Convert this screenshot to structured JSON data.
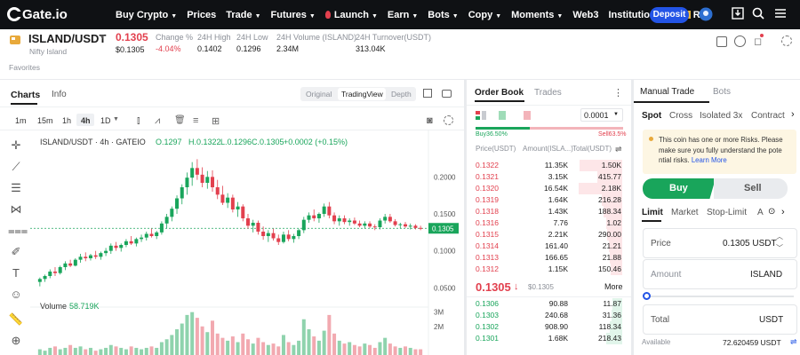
{
  "nav": {
    "logo": "Gate.io",
    "items": [
      {
        "label": "Buy Crypto",
        "caret": true
      },
      {
        "label": "Prices",
        "caret": false
      },
      {
        "label": "Trade",
        "caret": true
      },
      {
        "label": "Futures",
        "caret": true
      },
      {
        "label": "Launch",
        "caret": true
      },
      {
        "label": "Earn",
        "caret": true
      },
      {
        "label": "Bots",
        "caret": true
      },
      {
        "label": "Copy",
        "caret": true
      },
      {
        "label": "Moments",
        "caret": true
      },
      {
        "label": "Web3",
        "caret": false
      },
      {
        "label": "Institutional",
        "caret": true
      },
      {
        "label": "Re",
        "caret": false
      }
    ],
    "deposit": "Deposit"
  },
  "ticker": {
    "pair": "ISLAND/USDT",
    "name": "Nifty Island",
    "price": "0.1305",
    "price_usd": "$0.1305",
    "change_label": "Change %",
    "change_value": "-4.04%",
    "high_label": "24H High",
    "high_value": "0.1402",
    "low_label": "24H Low",
    "low_value": "0.1296",
    "volume_label": "24H Volume (ISLAND)",
    "volume_value": "2.34M",
    "turnover_label": "24H Turnover(USDT)",
    "turnover_value": "313.04K",
    "favorites": "Favorites"
  },
  "chart": {
    "tabs": {
      "charts": "Charts",
      "info": "Info"
    },
    "views": [
      "Original",
      "TradingView",
      "Depth"
    ],
    "timeframes": [
      "1m",
      "15m",
      "1h",
      "4h",
      "1D"
    ],
    "active_timeframe": "4h",
    "legend": {
      "symbol": "ISLAND/USDT · 4h · GATEIO",
      "o": "O.1297",
      "h": "H.0.1322",
      "l": "L.0.1296",
      "c": "C.0.1305",
      "chg": "+0.0002 (+0.15%)"
    },
    "volume_label": "Volume",
    "volume_value": "58.719K",
    "price_ticks": [
      "0.2000",
      "0.1500",
      "0.1000",
      "0.0500"
    ],
    "current_price_tag": "0.1305",
    "vol_ticks": [
      "3M",
      "2M"
    ]
  },
  "chart_data": {
    "type": "candlestick",
    "ylim": [
      0.03,
      0.24
    ],
    "y_ticks": [
      0.05,
      0.1,
      0.15,
      0.2
    ],
    "current": 0.1305,
    "candles_ohlc": [
      [
        0.058,
        0.064,
        0.052,
        0.062
      ],
      [
        0.062,
        0.068,
        0.058,
        0.066
      ],
      [
        0.066,
        0.075,
        0.063,
        0.072
      ],
      [
        0.072,
        0.078,
        0.066,
        0.07
      ],
      [
        0.07,
        0.08,
        0.068,
        0.078
      ],
      [
        0.078,
        0.086,
        0.074,
        0.083
      ],
      [
        0.083,
        0.088,
        0.078,
        0.08
      ],
      [
        0.08,
        0.09,
        0.079,
        0.088
      ],
      [
        0.088,
        0.096,
        0.084,
        0.092
      ],
      [
        0.092,
        0.098,
        0.086,
        0.09
      ],
      [
        0.09,
        0.096,
        0.087,
        0.094
      ],
      [
        0.094,
        0.1,
        0.089,
        0.092
      ],
      [
        0.092,
        0.099,
        0.088,
        0.097
      ],
      [
        0.097,
        0.104,
        0.093,
        0.1
      ],
      [
        0.1,
        0.11,
        0.096,
        0.107
      ],
      [
        0.107,
        0.112,
        0.1,
        0.104
      ],
      [
        0.104,
        0.11,
        0.099,
        0.108
      ],
      [
        0.108,
        0.116,
        0.105,
        0.113
      ],
      [
        0.113,
        0.12,
        0.108,
        0.11
      ],
      [
        0.11,
        0.118,
        0.106,
        0.116
      ],
      [
        0.116,
        0.122,
        0.112,
        0.118
      ],
      [
        0.118,
        0.126,
        0.114,
        0.123
      ],
      [
        0.123,
        0.13,
        0.118,
        0.12
      ],
      [
        0.12,
        0.127,
        0.116,
        0.125
      ],
      [
        0.125,
        0.14,
        0.122,
        0.137
      ],
      [
        0.137,
        0.15,
        0.13,
        0.146
      ],
      [
        0.146,
        0.16,
        0.14,
        0.157
      ],
      [
        0.157,
        0.175,
        0.15,
        0.171
      ],
      [
        0.171,
        0.19,
        0.163,
        0.186
      ],
      [
        0.186,
        0.206,
        0.176,
        0.199
      ],
      [
        0.199,
        0.22,
        0.188,
        0.212
      ],
      [
        0.212,
        0.224,
        0.196,
        0.203
      ],
      [
        0.203,
        0.213,
        0.186,
        0.192
      ],
      [
        0.192,
        0.208,
        0.184,
        0.2
      ],
      [
        0.2,
        0.209,
        0.18,
        0.186
      ],
      [
        0.186,
        0.196,
        0.17,
        0.176
      ],
      [
        0.176,
        0.188,
        0.162,
        0.165
      ],
      [
        0.165,
        0.178,
        0.158,
        0.172
      ],
      [
        0.172,
        0.176,
        0.152,
        0.156
      ],
      [
        0.156,
        0.166,
        0.146,
        0.16
      ],
      [
        0.16,
        0.163,
        0.14,
        0.144
      ],
      [
        0.144,
        0.15,
        0.13,
        0.134
      ],
      [
        0.134,
        0.142,
        0.125,
        0.138
      ],
      [
        0.138,
        0.141,
        0.122,
        0.126
      ],
      [
        0.126,
        0.133,
        0.115,
        0.12
      ],
      [
        0.12,
        0.128,
        0.112,
        0.124
      ],
      [
        0.124,
        0.13,
        0.114,
        0.117
      ],
      [
        0.117,
        0.122,
        0.108,
        0.112
      ],
      [
        0.112,
        0.126,
        0.11,
        0.122
      ],
      [
        0.122,
        0.128,
        0.113,
        0.116
      ],
      [
        0.116,
        0.123,
        0.111,
        0.12
      ],
      [
        0.12,
        0.13,
        0.116,
        0.128
      ],
      [
        0.128,
        0.146,
        0.124,
        0.142
      ],
      [
        0.142,
        0.152,
        0.138,
        0.148
      ],
      [
        0.148,
        0.156,
        0.14,
        0.144
      ],
      [
        0.144,
        0.152,
        0.138,
        0.15
      ],
      [
        0.15,
        0.164,
        0.146,
        0.16
      ],
      [
        0.16,
        0.166,
        0.144,
        0.148
      ],
      [
        0.148,
        0.152,
        0.136,
        0.14
      ],
      [
        0.14,
        0.148,
        0.134,
        0.144
      ],
      [
        0.144,
        0.148,
        0.136,
        0.139
      ],
      [
        0.139,
        0.144,
        0.134,
        0.141
      ],
      [
        0.141,
        0.145,
        0.135,
        0.137
      ],
      [
        0.137,
        0.141,
        0.132,
        0.134
      ],
      [
        0.134,
        0.14,
        0.13,
        0.137
      ],
      [
        0.137,
        0.14,
        0.131,
        0.133
      ],
      [
        0.133,
        0.136,
        0.128,
        0.132
      ],
      [
        0.132,
        0.144,
        0.129,
        0.141
      ],
      [
        0.141,
        0.15,
        0.137,
        0.146
      ],
      [
        0.146,
        0.15,
        0.138,
        0.14
      ],
      [
        0.14,
        0.143,
        0.133,
        0.135
      ],
      [
        0.135,
        0.138,
        0.13,
        0.136
      ],
      [
        0.136,
        0.139,
        0.131,
        0.133
      ],
      [
        0.133,
        0.137,
        0.129,
        0.134
      ],
      [
        0.134,
        0.136,
        0.129,
        0.131
      ],
      [
        0.131,
        0.134,
        0.128,
        0.1305
      ]
    ],
    "volumes": [
      0.4,
      0.3,
      0.5,
      0.6,
      0.4,
      0.5,
      0.7,
      0.5,
      0.6,
      0.4,
      0.5,
      0.3,
      0.4,
      0.5,
      0.7,
      0.6,
      0.5,
      0.4,
      0.6,
      0.5,
      0.4,
      0.5,
      0.6,
      0.5,
      0.9,
      1.1,
      1.4,
      1.8,
      2.2,
      2.8,
      3.0,
      2.6,
      2.0,
      1.6,
      2.4,
      1.5,
      1.2,
      1.0,
      1.3,
      0.9,
      1.5,
      1.1,
      0.8,
      1.2,
      0.9,
      0.7,
      0.8,
      0.6,
      1.4,
      0.9,
      0.7,
      1.0,
      2.5,
      1.8,
      1.3,
      1.0,
      1.7,
      2.8,
      1.5,
      1.0,
      0.8,
      0.9,
      0.7,
      0.6,
      0.8,
      0.7,
      0.5,
      0.9,
      1.2,
      0.8,
      0.6,
      0.5,
      0.6,
      0.5,
      0.4,
      0.4
    ]
  },
  "orderbook": {
    "tabs": {
      "book": "Order Book",
      "trades": "Trades"
    },
    "precision": "0.0001",
    "buy_pct": "Buy36.50%",
    "sell_pct": "Sell63.5%",
    "headers": {
      "price": "Price(USDT)",
      "amount": "Amount(ISLA...)",
      "total": "Total(USDT)"
    },
    "asks": [
      {
        "price": "0.1322",
        "amount": "11.35K",
        "total": "1.50K",
        "depth": 0.95
      },
      {
        "price": "0.1321",
        "amount": "3.15K",
        "total": "415.77",
        "depth": 0.55
      },
      {
        "price": "0.1320",
        "amount": "16.54K",
        "total": "2.18K",
        "depth": 0.98
      },
      {
        "price": "0.1319",
        "amount": "1.64K",
        "total": "216.28",
        "depth": 0.45
      },
      {
        "price": "0.1318",
        "amount": "1.43K",
        "total": "188.34",
        "depth": 0.42
      },
      {
        "price": "0.1316",
        "amount": "7.76",
        "total": "1.02",
        "depth": 0.35
      },
      {
        "price": "0.1315",
        "amount": "2.21K",
        "total": "290.00",
        "depth": 0.33
      },
      {
        "price": "0.1314",
        "amount": "161.40",
        "total": "21.21",
        "depth": 0.3
      },
      {
        "price": "0.1313",
        "amount": "166.65",
        "total": "21.88",
        "depth": 0.28
      },
      {
        "price": "0.1312",
        "amount": "1.15K",
        "total": "150.46",
        "depth": 0.26
      }
    ],
    "last_price": "0.1305",
    "last_arrow": "↓",
    "last_usd": "$0.1305",
    "more": "More",
    "bids": [
      {
        "price": "0.1306",
        "amount": "90.88",
        "total": "11.87",
        "depth": 0.22
      },
      {
        "price": "0.1303",
        "amount": "240.68",
        "total": "31.36",
        "depth": 0.24
      },
      {
        "price": "0.1302",
        "amount": "908.90",
        "total": "118.34",
        "depth": 0.28
      },
      {
        "price": "0.1301",
        "amount": "1.68K",
        "total": "218.43",
        "depth": 0.35
      }
    ]
  },
  "trade": {
    "tabs": {
      "manual": "Manual Trade",
      "bots": "Bots"
    },
    "modes": [
      "Spot",
      "Cross",
      "Isolated 3x",
      "Contract"
    ],
    "warning": "This coin has one or more Risks. Please make sure you fully understand the potential risks.",
    "learn_more": "Learn More",
    "buy": "Buy",
    "sell": "Sell",
    "order_types": [
      "Limit",
      "Market",
      "Stop-Limit",
      "A"
    ],
    "price_label": "Price",
    "price_value": "0.1305 USDT",
    "amount_label": "Amount",
    "amount_unit": "ISLAND",
    "total_label": "Total",
    "total_unit": "USDT",
    "available_label": "Available",
    "available_value": "72.620459 USDT"
  },
  "colors": {
    "up": "#19a55b",
    "down": "#e2404e",
    "accent": "#2354e6"
  }
}
